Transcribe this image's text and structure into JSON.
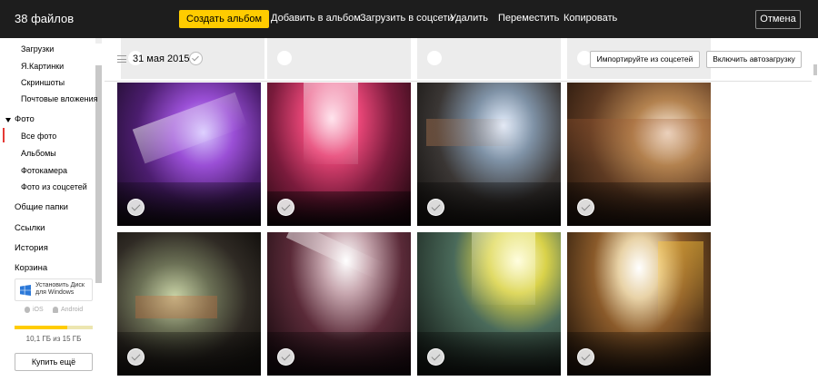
{
  "topbar": {
    "file_count": "38 файлов",
    "create_album": "Создать альбом",
    "actions": [
      "Добавить в альбом",
      "Загрузить в соцсети",
      "Удалить",
      "Переместить",
      "Копировать"
    ],
    "cancel": "Отмена"
  },
  "sidebar": {
    "items": [
      "Загрузки",
      "Я.Картинки",
      "Скриншоты",
      "Почтовые вложения"
    ],
    "photo_section": "Фото",
    "photo_items": [
      "Все фото",
      "Альбомы",
      "Фотокамера",
      "Фото из соцсетей"
    ],
    "main_items": [
      "Общие папки",
      "Ссылки",
      "История",
      "Корзина"
    ],
    "install": "Установить Диск для Windows",
    "install_line1": "Установить Диск",
    "install_line2": "для Windows",
    "ios": "iOS",
    "android": "Android",
    "storage_text": "10,1 ГБ из 15 ГБ",
    "storage_used_fraction": 0.673,
    "buy": "Купить ещё"
  },
  "content": {
    "date": "31 мая 2015",
    "import_button": "Импортируйте из соцсетей",
    "autoload_button": "Включить автозагрузку"
  },
  "colors": {
    "topbar_bg": "#1d1d1d",
    "accent_yellow": "#ffcc00",
    "active_red": "#e53935"
  },
  "icons": {
    "menu": "hamburger-icon",
    "check": "checkmark-icon",
    "windows": "windows-icon",
    "apple": "apple-icon",
    "android": "android-icon"
  }
}
